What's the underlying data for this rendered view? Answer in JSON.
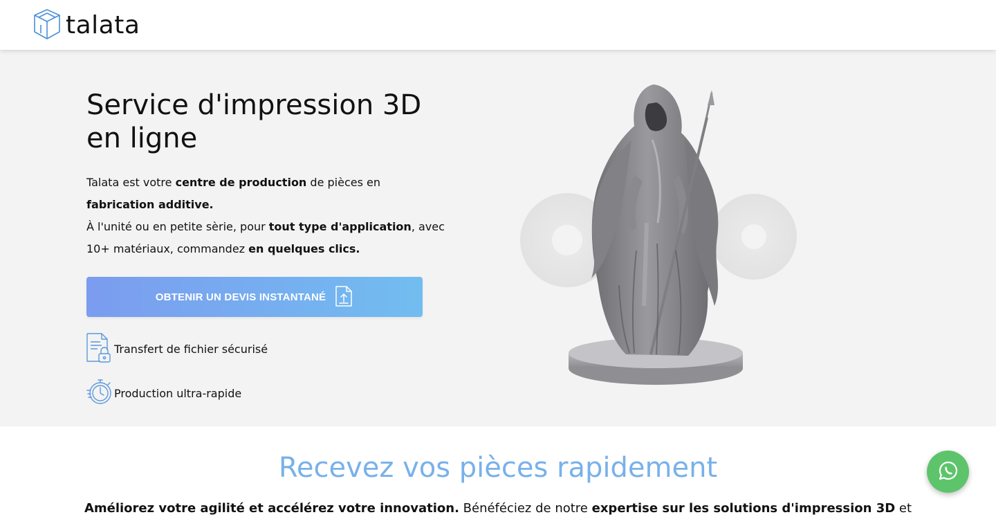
{
  "header": {
    "logo_text": "talata"
  },
  "hero": {
    "title": "Service d'impression 3D en ligne",
    "intro_1": "Talata est votre ",
    "intro_bold_1": "centre de production",
    "intro_2": " de pièces en ",
    "intro_bold_2": "fabrication additive.",
    "intro_3": "À l'unité ou en petite sèrie, pour ",
    "intro_bold_3": "tout type d'application",
    "intro_4": ", avec 10+ matériaux, commandez ",
    "intro_bold_4": "en quelques clics.",
    "cta_label": "OBTENIR UN DEVIS INSTANTANÉ",
    "cta_icon": "file-upload-icon",
    "features": [
      {
        "label": "Transfert de fichier sécurisé",
        "icon": "secure-file-icon"
      },
      {
        "label": "Production ultra-rapide",
        "icon": "stopwatch-icon"
      }
    ],
    "image": "3d-printed-figurine"
  },
  "section": {
    "title": "Recevez vos pièces rapidement",
    "text_bold_1": "Améliorez votre agilité et accélérez votre innovation.",
    "text_2": " Bénéféciez de notre ",
    "text_bold_3": "expertise sur les solutions d'impression 3D",
    "text_4": " et"
  },
  "floating": {
    "whatsapp_icon": "whatsapp-icon"
  },
  "colors": {
    "accent_blue": "#78b1ea",
    "cta_start": "#7b9cef",
    "cta_end": "#72bdf0",
    "whatsapp_green": "#5dc46b",
    "hero_bg": "#f3f3f3"
  }
}
